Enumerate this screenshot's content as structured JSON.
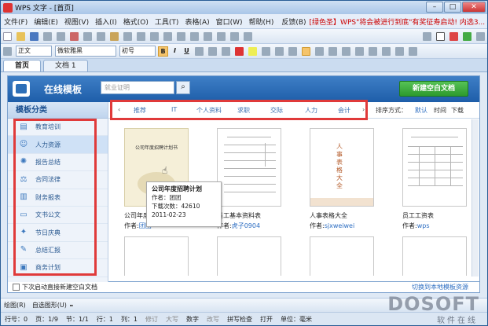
{
  "window": {
    "title": "WPS 文字 - [首页]"
  },
  "menu": {
    "items": [
      "文件(F)",
      "编辑(E)",
      "视图(V)",
      "插入(I)",
      "格式(O)",
      "工具(T)",
      "表格(A)",
      "窗口(W)",
      "帮助(H)"
    ],
    "feedback": "反馈(B)",
    "promo": "[绿色圣】WPS\"将会被进行到底\"有奖征寿启动! 内选3..."
  },
  "format": {
    "style": "正文",
    "font": "微软雅黑",
    "size": "初号"
  },
  "tabs": [
    {
      "label": "首页"
    },
    {
      "label": "文档 1"
    }
  ],
  "header": {
    "title": "在线模板",
    "search_placeholder": "就业证明",
    "new_doc": "新建空白文档"
  },
  "sidebar": {
    "heading": "模板分类",
    "items": [
      {
        "label": "教育培训",
        "icon": "book-icon"
      },
      {
        "label": "人力资源",
        "icon": "people-icon"
      },
      {
        "label": "报告总结",
        "icon": "chart-icon"
      },
      {
        "label": "合同法律",
        "icon": "scale-icon"
      },
      {
        "label": "财务报表",
        "icon": "table-icon"
      },
      {
        "label": "文书公文",
        "icon": "doc-icon"
      },
      {
        "label": "节日庆典",
        "icon": "gift-icon"
      },
      {
        "label": "总结汇报",
        "icon": "pin-icon"
      },
      {
        "label": "商务计划",
        "icon": "case-icon"
      }
    ]
  },
  "filters": [
    "推荐",
    "IT",
    "个人资料",
    "求职",
    "交际",
    "人力",
    "会计"
  ],
  "sort": {
    "label": "排序方式：",
    "options": [
      "默认",
      "时间",
      "下载"
    ]
  },
  "templates": [
    {
      "name": "公司年度招聘计划",
      "author_label": "作者:",
      "author": "团团",
      "thumb_title": "公司年度招聘计划书"
    },
    {
      "name": "员工基本资料表",
      "author_label": "作者:",
      "author": "虎子0904"
    },
    {
      "name": "人事表格大全",
      "author_label": "作者:",
      "author": "sjxweiwei",
      "thumb_title": "人事表格大全"
    },
    {
      "name": "员工工资表",
      "author_label": "作者:",
      "author": "wps"
    }
  ],
  "tooltip": {
    "title": "公司年度招聘计划",
    "author": "作者：团团",
    "downloads": "下载次数：42610",
    "date": "2011-02-23"
  },
  "bottom": {
    "checkbox_label": "下次启动直接新建空白文档",
    "switch_link": "切换到本地模板资源"
  },
  "drawbar": {
    "draw": "绘图(R)",
    "shapes": "自选图形(U)"
  },
  "status": [
    "行号：0",
    "页：1/9",
    "节：1/1",
    "行：1",
    "列：1",
    "修订",
    "大写",
    "数字",
    "改写",
    "拼写检查",
    "打开",
    "单位：毫米"
  ],
  "watermark": {
    "brand": "DOSOFT",
    "site": "软件在线"
  }
}
